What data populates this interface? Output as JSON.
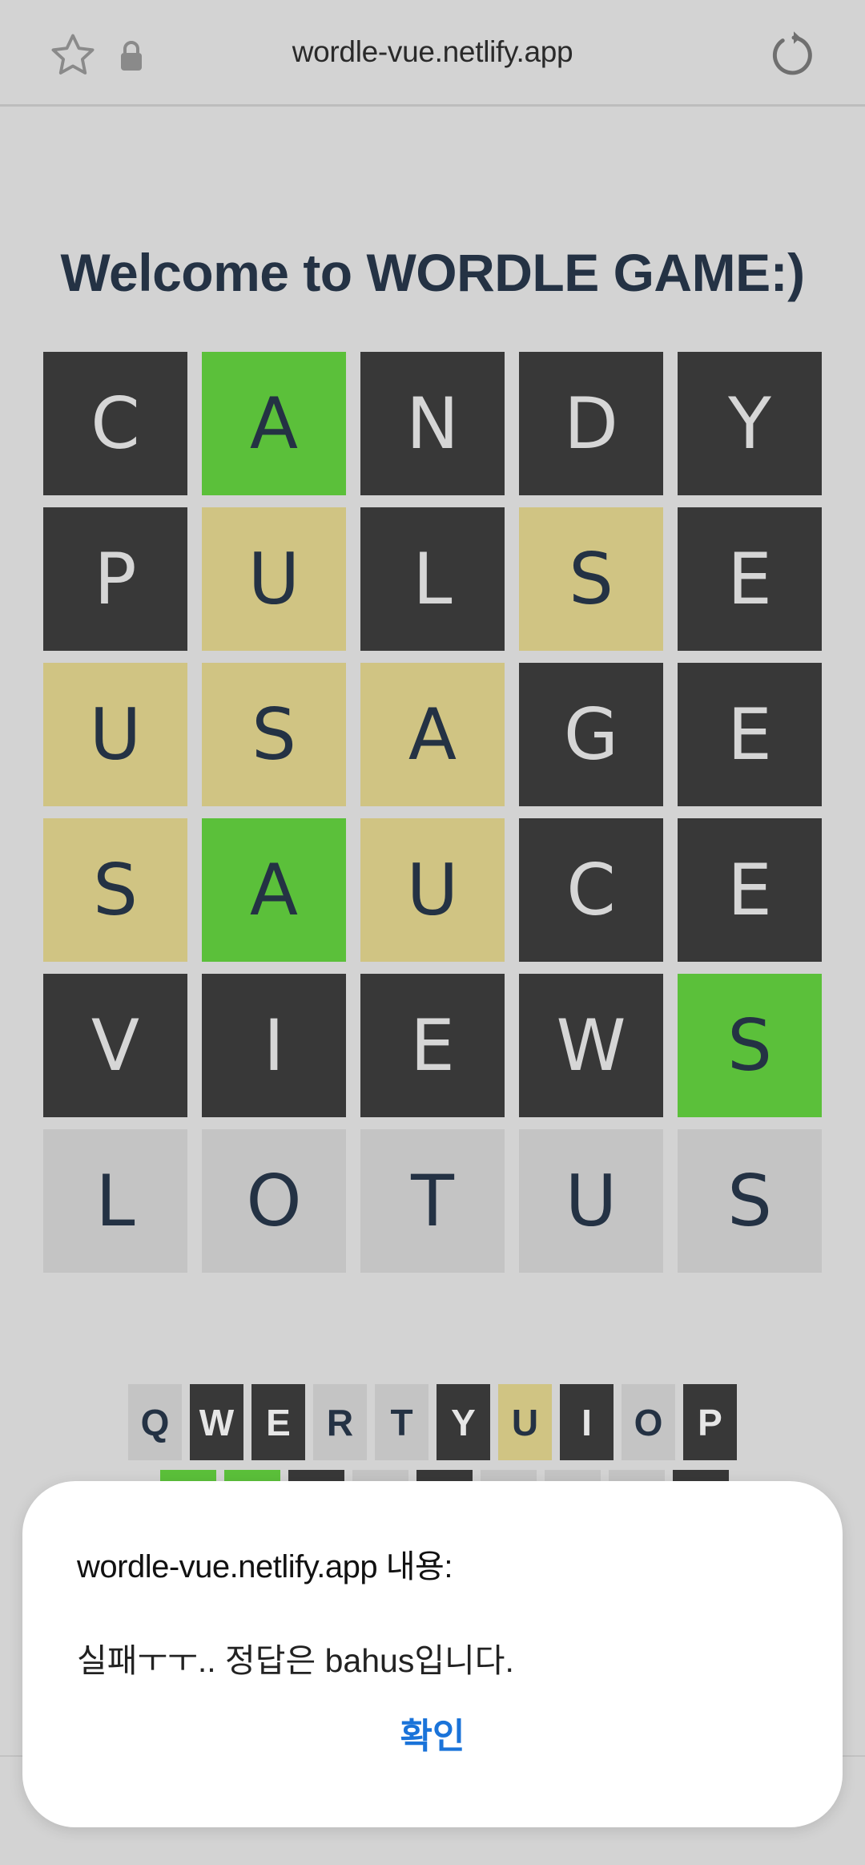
{
  "browser": {
    "url": "wordle-vue.netlify.app",
    "icons": [
      "star-icon",
      "lock-icon",
      "reload-icon"
    ]
  },
  "page": {
    "title": "Welcome to WORDLE GAME:)"
  },
  "board": {
    "rows": [
      {
        "tiles": [
          {
            "letter": "C",
            "state": "absent"
          },
          {
            "letter": "A",
            "state": "correct"
          },
          {
            "letter": "N",
            "state": "absent"
          },
          {
            "letter": "D",
            "state": "absent"
          },
          {
            "letter": "Y",
            "state": "absent"
          }
        ]
      },
      {
        "tiles": [
          {
            "letter": "P",
            "state": "absent"
          },
          {
            "letter": "U",
            "state": "present"
          },
          {
            "letter": "L",
            "state": "absent"
          },
          {
            "letter": "S",
            "state": "present"
          },
          {
            "letter": "E",
            "state": "absent"
          }
        ]
      },
      {
        "tiles": [
          {
            "letter": "U",
            "state": "present"
          },
          {
            "letter": "S",
            "state": "present"
          },
          {
            "letter": "A",
            "state": "present"
          },
          {
            "letter": "G",
            "state": "absent"
          },
          {
            "letter": "E",
            "state": "absent"
          }
        ]
      },
      {
        "tiles": [
          {
            "letter": "S",
            "state": "present"
          },
          {
            "letter": "A",
            "state": "correct"
          },
          {
            "letter": "U",
            "state": "present"
          },
          {
            "letter": "C",
            "state": "absent"
          },
          {
            "letter": "E",
            "state": "absent"
          }
        ]
      },
      {
        "tiles": [
          {
            "letter": "V",
            "state": "absent"
          },
          {
            "letter": "I",
            "state": "absent"
          },
          {
            "letter": "E",
            "state": "absent"
          },
          {
            "letter": "W",
            "state": "absent"
          },
          {
            "letter": "S",
            "state": "correct"
          }
        ]
      },
      {
        "tiles": [
          {
            "letter": "L",
            "state": "input"
          },
          {
            "letter": "O",
            "state": "input"
          },
          {
            "letter": "T",
            "state": "input"
          },
          {
            "letter": "U",
            "state": "input"
          },
          {
            "letter": "S",
            "state": "input"
          }
        ]
      }
    ]
  },
  "keyboard": {
    "row1": [
      {
        "key": "Q",
        "state": "unused"
      },
      {
        "key": "W",
        "state": "absent"
      },
      {
        "key": "E",
        "state": "absent"
      },
      {
        "key": "R",
        "state": "unused"
      },
      {
        "key": "T",
        "state": "unused"
      },
      {
        "key": "Y",
        "state": "absent"
      },
      {
        "key": "U",
        "state": "present"
      },
      {
        "key": "I",
        "state": "absent"
      },
      {
        "key": "O",
        "state": "unused"
      },
      {
        "key": "P",
        "state": "absent"
      }
    ]
  },
  "dialog": {
    "title": "wordle-vue.netlify.app 내용:",
    "message": "실패ㅜㅜ.. 정답은 bahus입니다.",
    "confirm_label": "확인"
  },
  "colors": {
    "absent": "#383838",
    "correct": "#5bc03a",
    "present": "#d0c483",
    "input": "#c4c4c4",
    "title": "#243244",
    "link": "#1a73d9"
  }
}
